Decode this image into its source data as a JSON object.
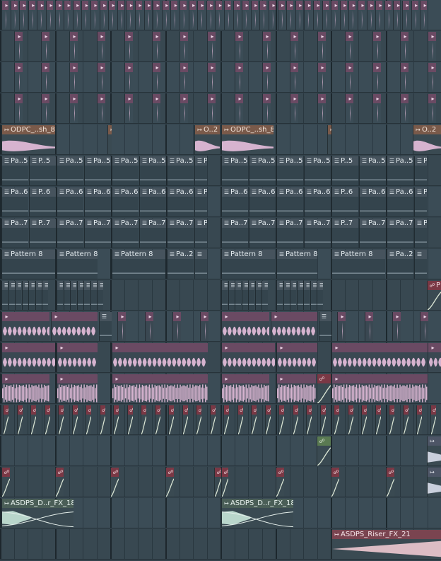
{
  "app": "FL Studio Playlist",
  "colors": {
    "track_bg": "#3b4c56",
    "track_bg_alt": "#384851",
    "grid_line": "#26333b",
    "drum_header": "#6a4a63",
    "drum_body": "#d6b3cf",
    "brown_header": "#7a5a4a",
    "pattern_header": "#46535d",
    "pattern_body": "#34444d",
    "green_header": "#5a7a52",
    "teal_header": "#4a5e57",
    "teal_wave": "#b9d6cb",
    "riser_header": "#7a4450",
    "riser_wave": "#dcbcc4",
    "slate_header": "#4d5566",
    "red_header": "#7a3845"
  },
  "clip_labels": {
    "odpc_full": "ODPC_..sh_8",
    "odpc_short": "O..2",
    "pa5": "Pa..5",
    "p5": "P..5",
    "pa6": "Pa..6",
    "p6": "P..6",
    "pa7": "Pa..7",
    "p7": "P..7",
    "pattern8": "Pattern 8",
    "pa2": "Pa..2",
    "p_trunc": "P",
    "asdps_fx18": "ASDPS_D..r_FX_18",
    "asdps_riser": "ASDPS_Riser_FX_21"
  },
  "clip_icons": {
    "audio": "audio-clip-icon",
    "pattern": "pattern-clip-icon",
    "automation": "automation-clip-icon"
  }
}
